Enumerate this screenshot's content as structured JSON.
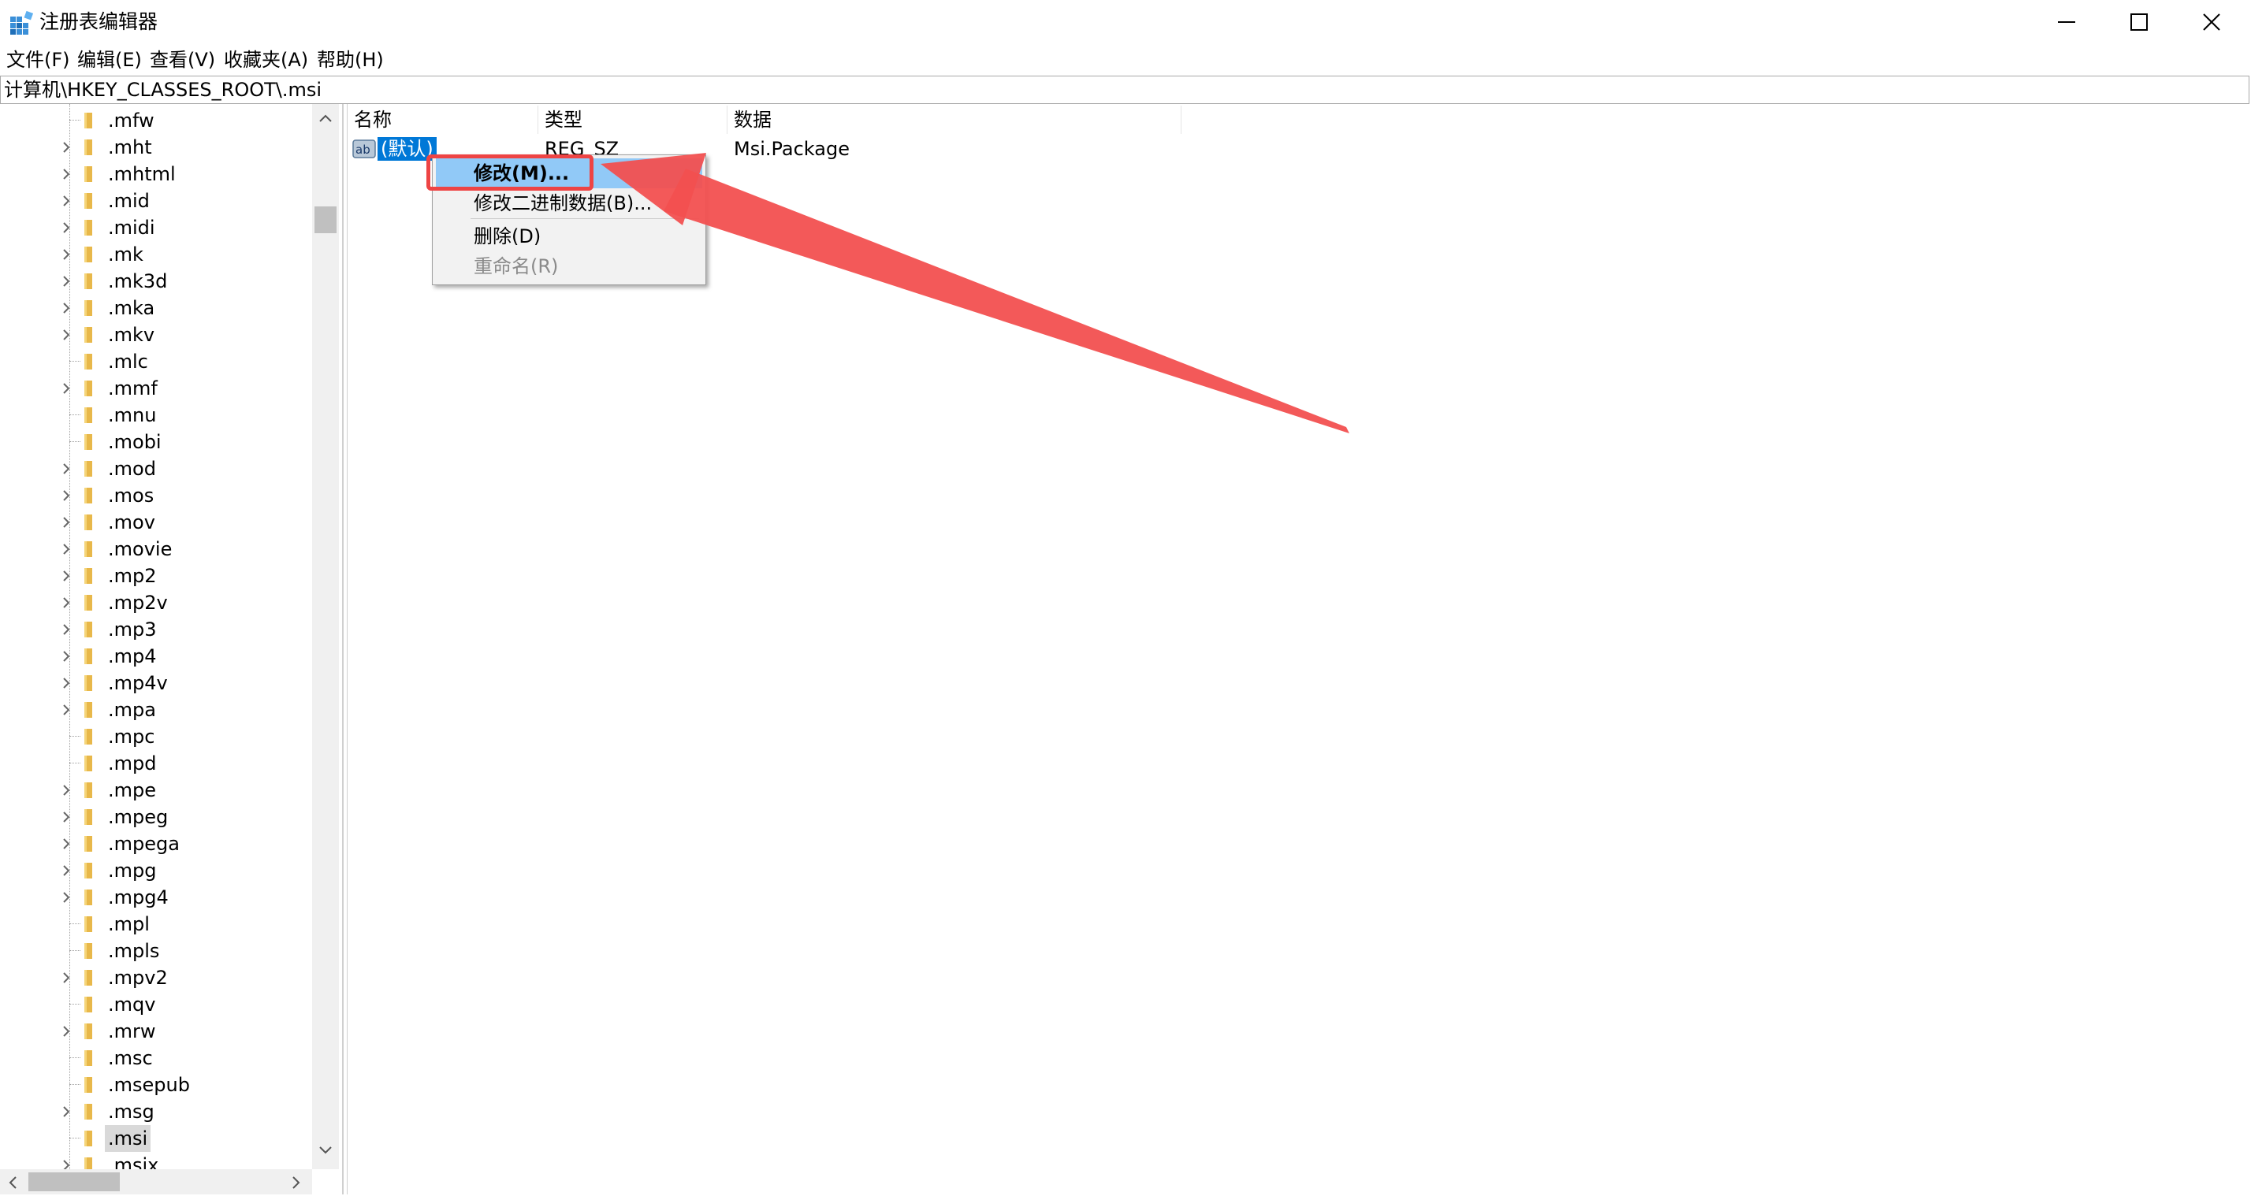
{
  "window": {
    "title": "注册表编辑器"
  },
  "menu": [
    "文件(F)",
    "编辑(E)",
    "查看(V)",
    "收藏夹(A)",
    "帮助(H)"
  ],
  "address": "计算机\\HKEY_CLASSES_ROOT\\.msi",
  "tree": {
    "items": [
      {
        "label": ".mfw",
        "expandable": false
      },
      {
        "label": ".mht",
        "expandable": true
      },
      {
        "label": ".mhtml",
        "expandable": true
      },
      {
        "label": ".mid",
        "expandable": true
      },
      {
        "label": ".midi",
        "expandable": true
      },
      {
        "label": ".mk",
        "expandable": true
      },
      {
        "label": ".mk3d",
        "expandable": true
      },
      {
        "label": ".mka",
        "expandable": true
      },
      {
        "label": ".mkv",
        "expandable": true
      },
      {
        "label": ".mlc",
        "expandable": false
      },
      {
        "label": ".mmf",
        "expandable": true
      },
      {
        "label": ".mnu",
        "expandable": false
      },
      {
        "label": ".mobi",
        "expandable": false
      },
      {
        "label": ".mod",
        "expandable": true
      },
      {
        "label": ".mos",
        "expandable": true
      },
      {
        "label": ".mov",
        "expandable": true
      },
      {
        "label": ".movie",
        "expandable": true
      },
      {
        "label": ".mp2",
        "expandable": true
      },
      {
        "label": ".mp2v",
        "expandable": true
      },
      {
        "label": ".mp3",
        "expandable": true
      },
      {
        "label": ".mp4",
        "expandable": true
      },
      {
        "label": ".mp4v",
        "expandable": true
      },
      {
        "label": ".mpa",
        "expandable": true
      },
      {
        "label": ".mpc",
        "expandable": false
      },
      {
        "label": ".mpd",
        "expandable": false
      },
      {
        "label": ".mpe",
        "expandable": true
      },
      {
        "label": ".mpeg",
        "expandable": true
      },
      {
        "label": ".mpega",
        "expandable": true
      },
      {
        "label": ".mpg",
        "expandable": true
      },
      {
        "label": ".mpg4",
        "expandable": true
      },
      {
        "label": ".mpl",
        "expandable": false
      },
      {
        "label": ".mpls",
        "expandable": false
      },
      {
        "label": ".mpv2",
        "expandable": true
      },
      {
        "label": ".mqv",
        "expandable": false
      },
      {
        "label": ".mrw",
        "expandable": true
      },
      {
        "label": ".msc",
        "expandable": false
      },
      {
        "label": ".msepub",
        "expandable": false
      },
      {
        "label": ".msg",
        "expandable": true
      },
      {
        "label": ".msi",
        "expandable": false,
        "selected": true
      },
      {
        "label": ".msix",
        "expandable": true
      }
    ]
  },
  "list": {
    "headers": {
      "name": "名称",
      "type": "类型",
      "data": "数据"
    },
    "row": {
      "name": "(默认)",
      "type": "REG_SZ",
      "data": "Msi.Package",
      "icon": "ab-string-icon"
    }
  },
  "context_menu": {
    "modify": "修改(M)...",
    "modify_binary": "修改二进制数据(B)...",
    "delete": "删除(D)",
    "rename": "重命名(R)"
  },
  "colors": {
    "selection": "#0078d7",
    "menu_highlight": "#91c9f7",
    "annotation": "#ee4444"
  }
}
